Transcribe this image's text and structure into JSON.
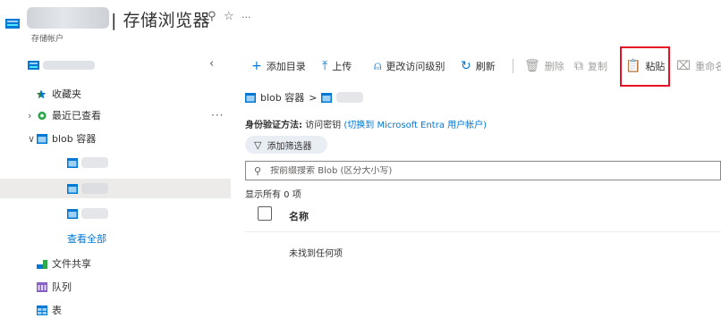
{
  "header": {
    "title": "| 存储浏览器",
    "subtitle": "存储帐户",
    "pin_glyph": "⚲",
    "favorite_glyph": "☆",
    "more_glyph": "···"
  },
  "tree": {
    "collapse_glyph": "‹",
    "items": [
      {
        "label": "收藏夹"
      },
      {
        "label": "最近已查看",
        "chevron": "›",
        "more": "···"
      },
      {
        "label": "blob 容器",
        "chevron": "∨"
      },
      {
        "label": ""
      },
      {
        "label": ""
      },
      {
        "label": ""
      },
      {
        "label": "查看全部"
      },
      {
        "label": "文件共享"
      },
      {
        "label": "队列"
      },
      {
        "label": "表"
      }
    ]
  },
  "toolbar": {
    "add_dir": "添加目录",
    "upload": "上传",
    "change_tier": "更改访问级别",
    "refresh": "刷新",
    "delete": "删除",
    "copy": "复制",
    "paste": "粘贴",
    "rename": "重命名"
  },
  "breadcrumb": {
    "root": "blob 容器",
    "sep": ">"
  },
  "auth": {
    "label": "身份验证方法:",
    "value": "访问密钥",
    "switch_link": "(切换到 Microsoft Entra 用户帐户)"
  },
  "filter": {
    "label": "添加筛选器"
  },
  "search": {
    "placeholder": "按前缀搜索 Blob (区分大小写)"
  },
  "list": {
    "count_text": "显示所有 0 项",
    "col_name": "名称",
    "empty_text": "未找到任何项"
  },
  "colors": {
    "accent": "#0078d4",
    "highlight": "#e81123"
  }
}
